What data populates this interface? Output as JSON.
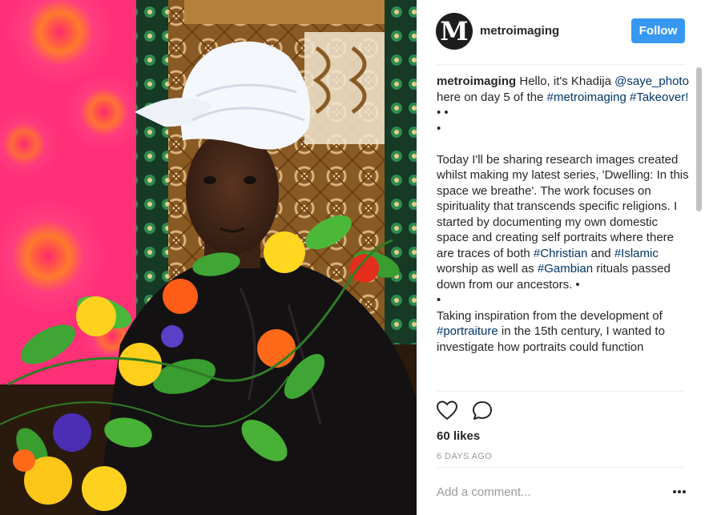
{
  "post": {
    "photo_alt": "Portrait of Khadija wearing a white head wrap and a garland of artificial flowers in front of printed textiles"
  },
  "header": {
    "avatar_letter": "M",
    "username": "metroimaging",
    "follow_label": "Follow"
  },
  "caption": {
    "username": "metroimaging",
    "line1_text": "Hello, it's Khadija",
    "mention": "@saye_photo",
    "line2_text": "here on day 5 of the",
    "hashtag_metroimaging": "#metroimaging",
    "hashtag_takeover": "#Takeover!",
    "bullets_1": "• •",
    "bullet_2": "•",
    "para2": "Today I'll be sharing research images created whilst making my latest series, 'Dwelling: In this space we breathe'. The work focuses on spirituality that transcends specific religions. I started by documenting my own domestic space and creating self portraits where there are traces of both",
    "hashtag_christian": "#Christian",
    "and": "and",
    "hashtag_islamic": "#Islamic",
    "worship_text": "worship as well as",
    "hashtag_gambian": "#Gambian",
    "rituals_text": "rituals passed down from our ancestors. •",
    "bullet_3": "•",
    "para3_start": "Taking inspiration from the development of",
    "hashtag_portraiture": "#portraiture",
    "para3_end": "in the 15th century, I wanted to investigate how portraits could function"
  },
  "actions": {
    "heart_icon": "heart-outline-icon",
    "comment_icon": "speech-bubble-icon"
  },
  "likes_text": "60 likes",
  "time_ago": "6 DAYS AGO",
  "comment_box": {
    "placeholder": "Add a comment...",
    "more_icon": "ellipsis-icon"
  },
  "colors": {
    "follow_blue": "#3897f0",
    "link_blue": "#003569",
    "muted_gray": "#999999"
  }
}
